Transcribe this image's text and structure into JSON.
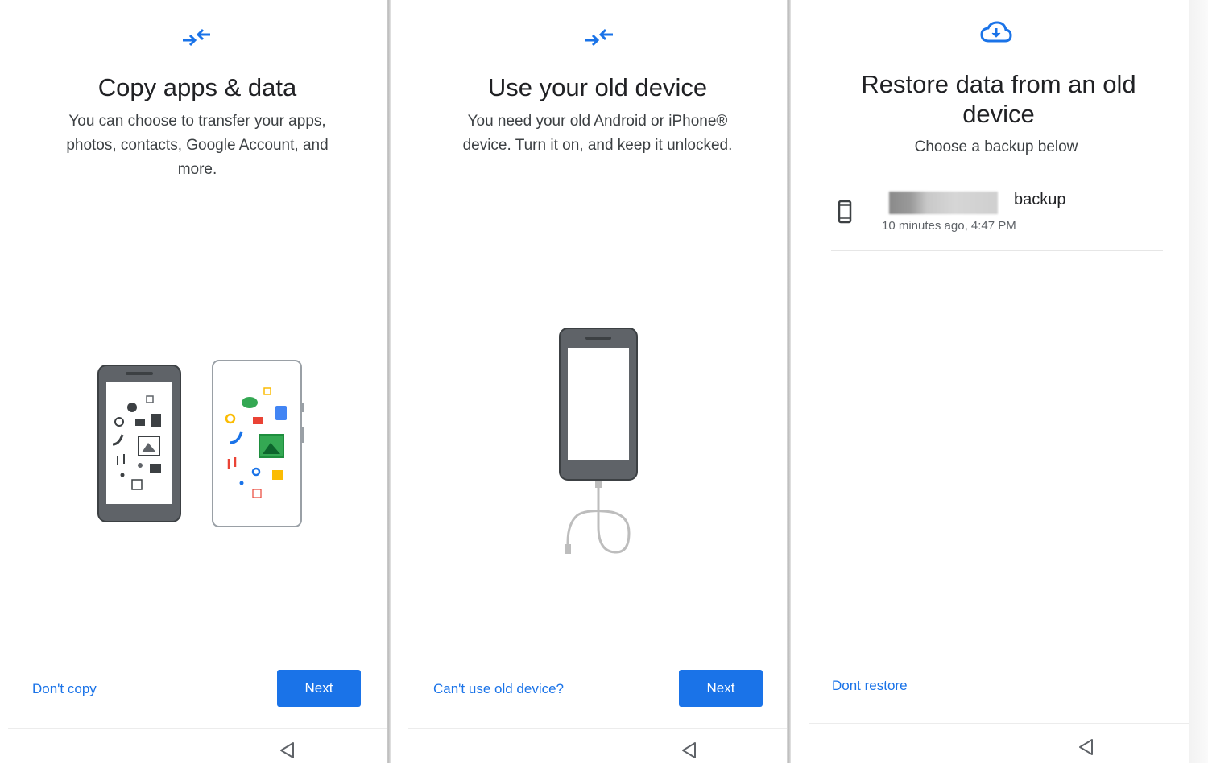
{
  "screens": [
    {
      "header_icon": "transfer-arrows-icon",
      "title": "Copy apps & data",
      "description": "You can choose to transfer your apps, photos, contacts, Google Account, and more.",
      "secondary_label": "Don't copy",
      "primary_label": "Next"
    },
    {
      "header_icon": "transfer-arrows-icon",
      "title": "Use your old device",
      "description": "You need your old Android or iPhone® device. Turn it on, and keep it unlocked.",
      "secondary_label": "Can't use old device?",
      "primary_label": "Next"
    },
    {
      "header_icon": "cloud-download-icon",
      "title": "Restore data from an old device",
      "subtitle": "Choose a backup below",
      "backup": {
        "name": "backup",
        "meta": "10 minutes ago, 4:47 PM",
        "icon": "phone-icon"
      },
      "secondary_label": "Dont restore"
    }
  ],
  "nav": {
    "icon": "back-triangle-icon"
  },
  "colors": {
    "accent": "#1a73e8",
    "text": "#202124",
    "subtext": "#3c4043"
  }
}
